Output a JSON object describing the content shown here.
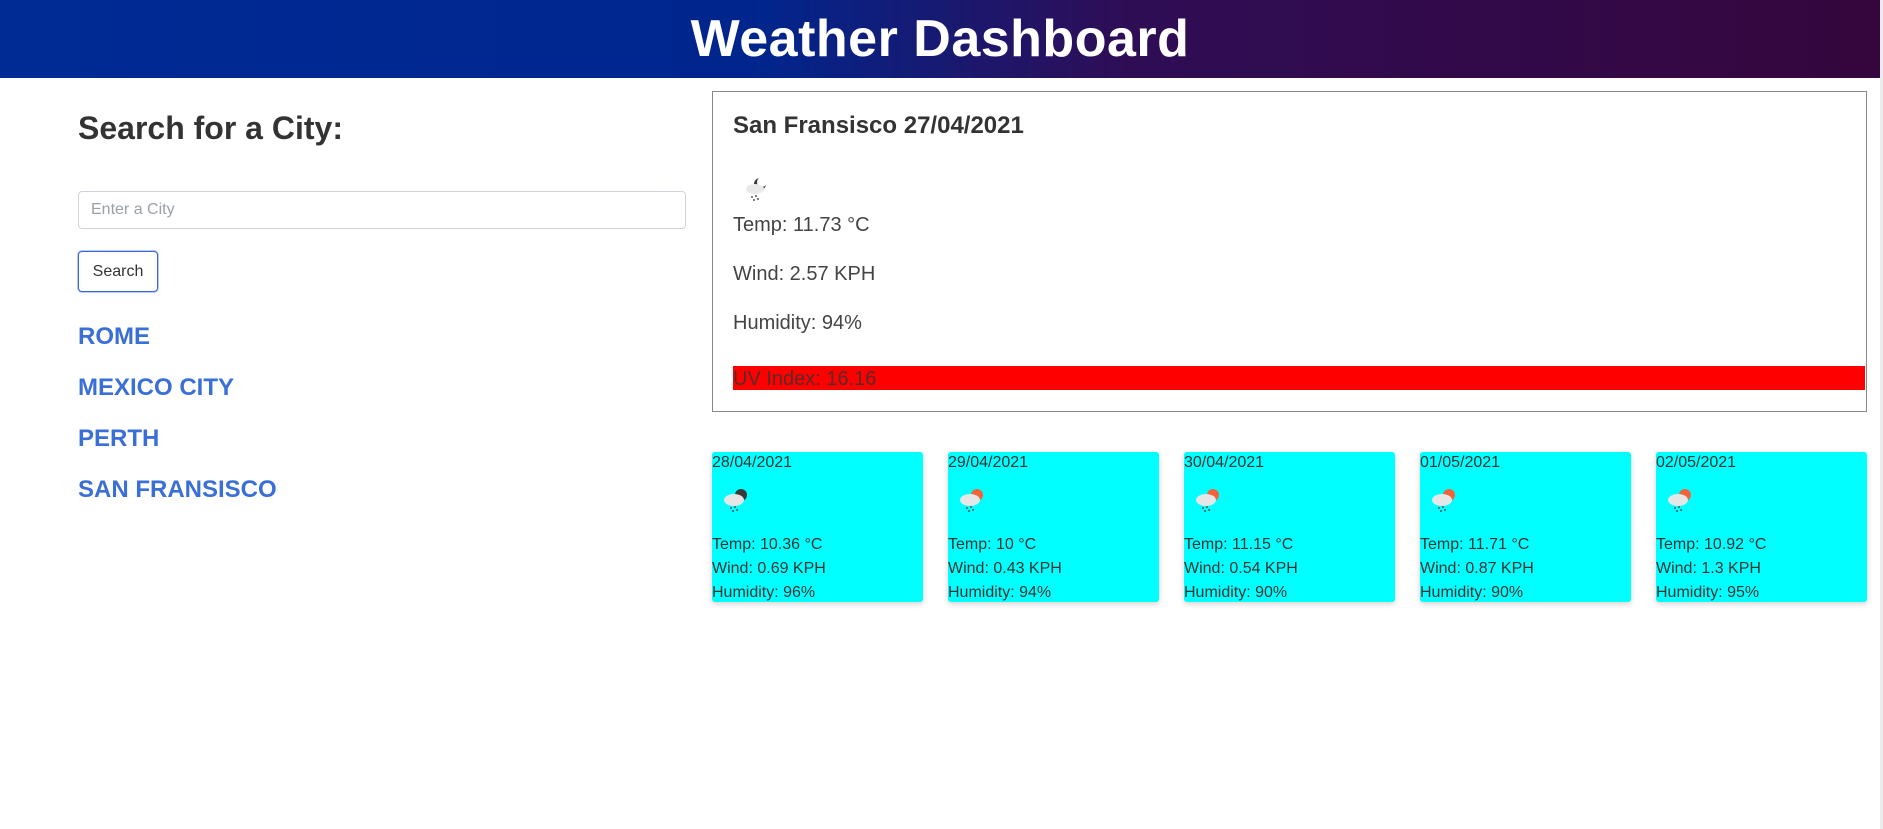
{
  "header": {
    "title": "Weather Dashboard"
  },
  "search": {
    "title": "Search for a City:",
    "placeholder": "Enter a City",
    "button_label": "Search"
  },
  "history": [
    "ROME",
    "MEXICO CITY",
    "PERTH",
    "SAN FRANSISCO"
  ],
  "current": {
    "city_date": "San Fransisco 27/04/2021",
    "icon": "snow-night-icon",
    "temp": "Temp: 11.73 °C",
    "wind": "Wind: 2.57 KPH",
    "humidity": "Humidity: 94%",
    "uv": "UV Index: 16.16",
    "uv_color": "#ff0000"
  },
  "forecast": [
    {
      "date": "28/04/2021",
      "icon": "snow-night-icon",
      "temp": "Temp: 10.36 °C",
      "wind": "Wind: 0.69 KPH",
      "humidity": "Humidity: 96%"
    },
    {
      "date": "29/04/2021",
      "icon": "snow-day-icon",
      "temp": "Temp: 10 °C",
      "wind": "Wind: 0.43 KPH",
      "humidity": "Humidity: 94%"
    },
    {
      "date": "30/04/2021",
      "icon": "snow-day-icon",
      "temp": "Temp: 11.15 °C",
      "wind": "Wind: 0.54 KPH",
      "humidity": "Humidity: 90%"
    },
    {
      "date": "01/05/2021",
      "icon": "snow-day-icon",
      "temp": "Temp: 11.71 °C",
      "wind": "Wind: 0.87 KPH",
      "humidity": "Humidity: 90%"
    },
    {
      "date": "02/05/2021",
      "icon": "snow-day-icon",
      "temp": "Temp: 10.92 °C",
      "wind": "Wind: 1.3 KPH",
      "humidity": "Humidity: 95%"
    }
  ],
  "colors": {
    "forecast_bg": "#00ffff",
    "link": "#3a6fd8",
    "header_left": "#002a94",
    "header_right": "#35063d"
  }
}
